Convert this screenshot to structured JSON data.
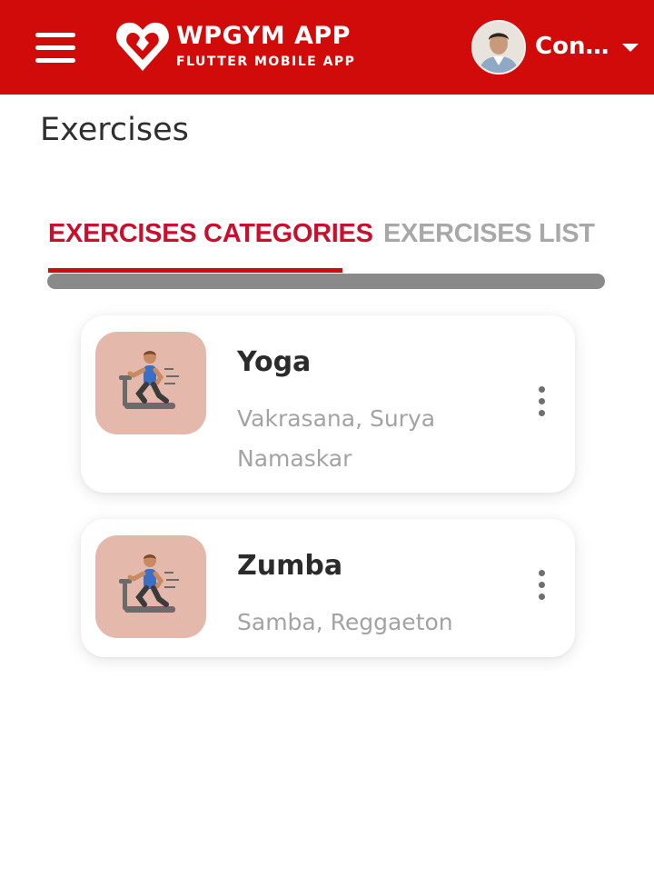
{
  "header": {
    "brand_name": "WPGYM APP",
    "brand_sub": "FLUTTER MOBILE APP",
    "user_name": "Con…",
    "brand_color": "#d10a0a",
    "icons": [
      "menu-icon",
      "wpgym-logo-icon",
      "user-avatar",
      "chevron-down-icon"
    ]
  },
  "page": {
    "title": "Exercises"
  },
  "tabs": [
    {
      "label": "EXERCISES CATEGORIES",
      "active": true
    },
    {
      "label": "EXERCISES LIST",
      "active": false
    }
  ],
  "categories": [
    {
      "title": "Yoga",
      "subtitle": "Vakrasana, Surya Namaskar",
      "icon": "treadmill-runner-icon",
      "menu_icon": "more-vertical-icon"
    },
    {
      "title": "Zumba",
      "subtitle": "Samba, Reggaeton",
      "icon": "treadmill-runner-icon",
      "menu_icon": "more-vertical-icon"
    }
  ],
  "colors": {
    "accent": "#c8102e",
    "tab_inactive": "#a8a8a8",
    "thumb_bg": "#e4b9ab",
    "subtitle": "#a3a3a3"
  }
}
